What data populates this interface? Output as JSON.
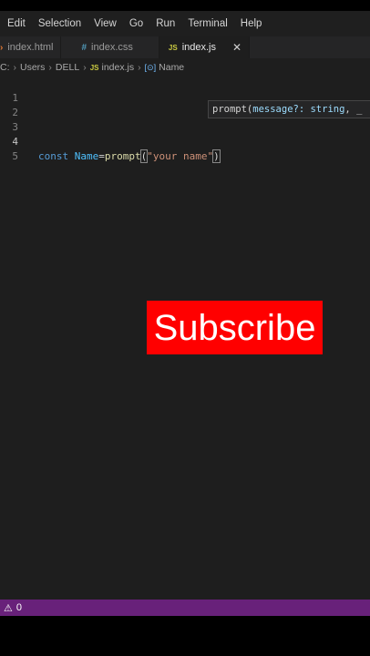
{
  "menu": [
    "Edit",
    "Selection",
    "View",
    "Go",
    "Run",
    "Terminal",
    "Help"
  ],
  "tabs": [
    {
      "icon": "›",
      "label": "index.html",
      "active": false
    },
    {
      "icon": "#",
      "label": "index.css",
      "active": false
    },
    {
      "icon": "JS",
      "label": "index.js",
      "active": true,
      "close": "✕"
    }
  ],
  "breadcrumb": {
    "drive": "C:",
    "parts": [
      "Users",
      "DELL",
      "index.js",
      "Name"
    ],
    "js_icon": "JS",
    "symbol_icon": "[⊙]"
  },
  "editor": {
    "line_numbers": [
      "1",
      "2",
      "3",
      "4",
      "5"
    ],
    "current_line": "4",
    "code": {
      "keyword": "const",
      "variable": "Name",
      "equals": "=",
      "function": "prompt",
      "open_paren": "(",
      "string": "\"your name\"",
      "close_paren": ")"
    },
    "hint": {
      "fn": "prompt(",
      "param": "message?: string",
      "rest": ", _"
    }
  },
  "overlay": {
    "subscribe": "Subscribe"
  },
  "statusbar": {
    "warning_icon": "⚠",
    "count": "0"
  },
  "colors": {
    "accent_status": "#68217a",
    "subscribe_bg": "#ff0000"
  }
}
